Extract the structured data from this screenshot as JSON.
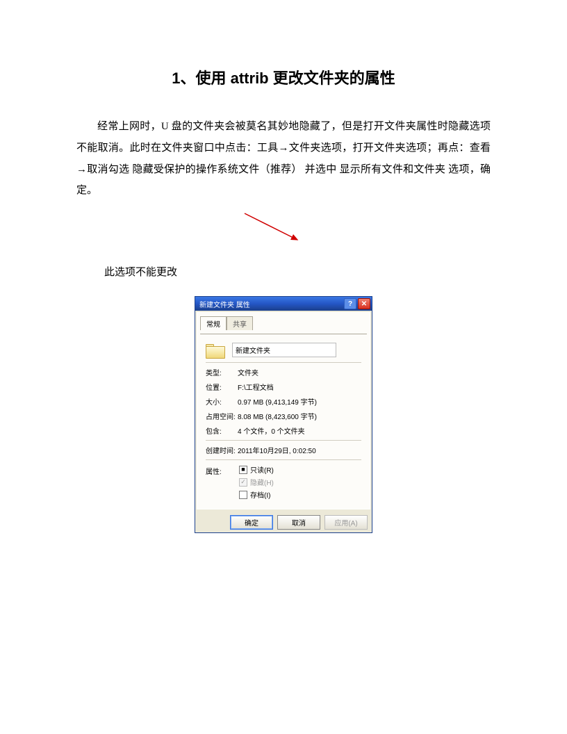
{
  "title": "1、使用 attrib 更改文件夹的属性",
  "paragraph": "经常上网时，U 盘的文件夹会被莫名其妙地隐藏了，但是打开文件夹属性时隐藏选项不能取消。此时在文件夹窗口中点击：工具→文件夹选项，打开文件夹选项；再点：查看→取消勾选 隐藏受保护的操作系统文件（推荐） 并选中 显示所有文件和文件夹 选项，确定。",
  "caption": "此选项不能更改",
  "dialog": {
    "title": "新建文件夹 属性",
    "tabs": {
      "general": "常规",
      "share": "共享"
    },
    "name_value": "新建文件夹",
    "labels": {
      "type": "类型:",
      "location": "位置:",
      "size": "大小:",
      "size_on_disk": "占用空间:",
      "contains": "包含:",
      "created": "创建时间:",
      "attributes": "属性:"
    },
    "values": {
      "type": "文件夹",
      "location": "F:\\工程文档",
      "size": "0.97 MB (9,413,149 字节)",
      "size_on_disk": "8.08 MB (8,423,600 字节)",
      "contains": "4 个文件，0 个文件夹",
      "created": "2011年10月29日, 0:02:50"
    },
    "checkboxes": {
      "readonly": "只读(R)",
      "hidden": "隐藏(H)",
      "archive": "存档(I)"
    },
    "buttons": {
      "ok": "确定",
      "cancel": "取消",
      "apply": "应用(A)"
    }
  }
}
